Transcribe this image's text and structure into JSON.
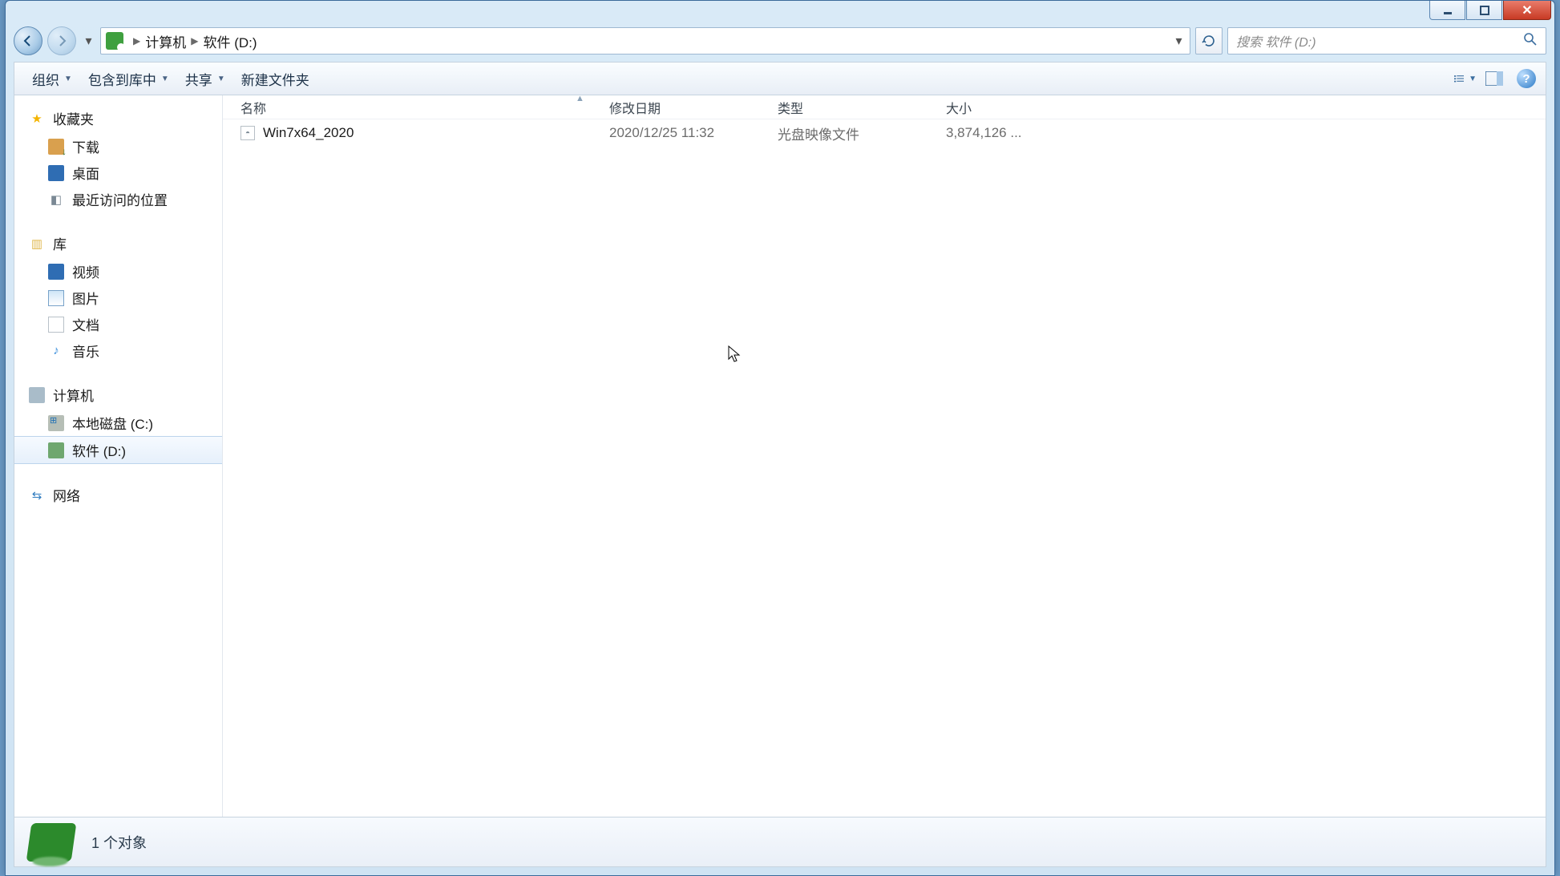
{
  "breadcrumb": {
    "computer": "计算机",
    "drive": "软件 (D:)"
  },
  "search": {
    "placeholder": "搜索 软件 (D:)"
  },
  "toolbar": {
    "organize": "组织",
    "include": "包含到库中",
    "share": "共享",
    "newfolder": "新建文件夹"
  },
  "columns": {
    "name": "名称",
    "date": "修改日期",
    "type": "类型",
    "size": "大小"
  },
  "sidebar": {
    "favorites": "收藏夹",
    "downloads": "下载",
    "desktop": "桌面",
    "recent": "最近访问的位置",
    "libraries": "库",
    "videos": "视频",
    "pictures": "图片",
    "documents": "文档",
    "music": "音乐",
    "computer": "计算机",
    "localdisk": "本地磁盘 (C:)",
    "software": "软件 (D:)",
    "network": "网络"
  },
  "files": {
    "row0": {
      "name": "Win7x64_2020",
      "date": "2020/12/25 11:32",
      "type": "光盘映像文件",
      "size": "3,874,126 ..."
    }
  },
  "status": {
    "count": "1 个对象"
  }
}
